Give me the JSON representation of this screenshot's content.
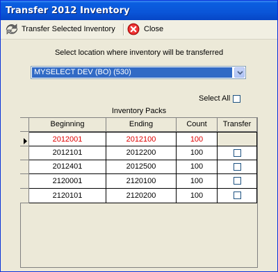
{
  "window": {
    "title": "Transfer 2012 Inventory"
  },
  "toolbar": {
    "transfer_label": "Transfer Selected Inventory",
    "close_label": "Close"
  },
  "location": {
    "prompt": "Select location where inventory will be transferred",
    "selected": "MYSELECT DEV (BO) (530)"
  },
  "select_all_label": "Select All",
  "grid": {
    "band_header": "Inventory Packs",
    "columns": [
      "Beginning",
      "Ending",
      "Count",
      "Transfer"
    ],
    "rows": [
      {
        "beginning": "2012001",
        "ending": "2012100",
        "count": "100",
        "current": true,
        "highlight_color": "#e00000"
      },
      {
        "beginning": "2012101",
        "ending": "2012200",
        "count": "100",
        "current": false
      },
      {
        "beginning": "2012401",
        "ending": "2012500",
        "count": "100",
        "current": false
      },
      {
        "beginning": "2120001",
        "ending": "2120100",
        "count": "100",
        "current": false
      },
      {
        "beginning": "2120101",
        "ending": "2120200",
        "count": "100",
        "current": false
      }
    ]
  },
  "colors": {
    "title_bar": "#0a55d8",
    "selection": "#316ac5",
    "highlight_text": "#e00000"
  },
  "icons": {
    "transfer": "transfer-icon",
    "close": "close-icon",
    "dropdown": "chevron-down-icon",
    "row_pointer": "row-pointer-icon"
  }
}
